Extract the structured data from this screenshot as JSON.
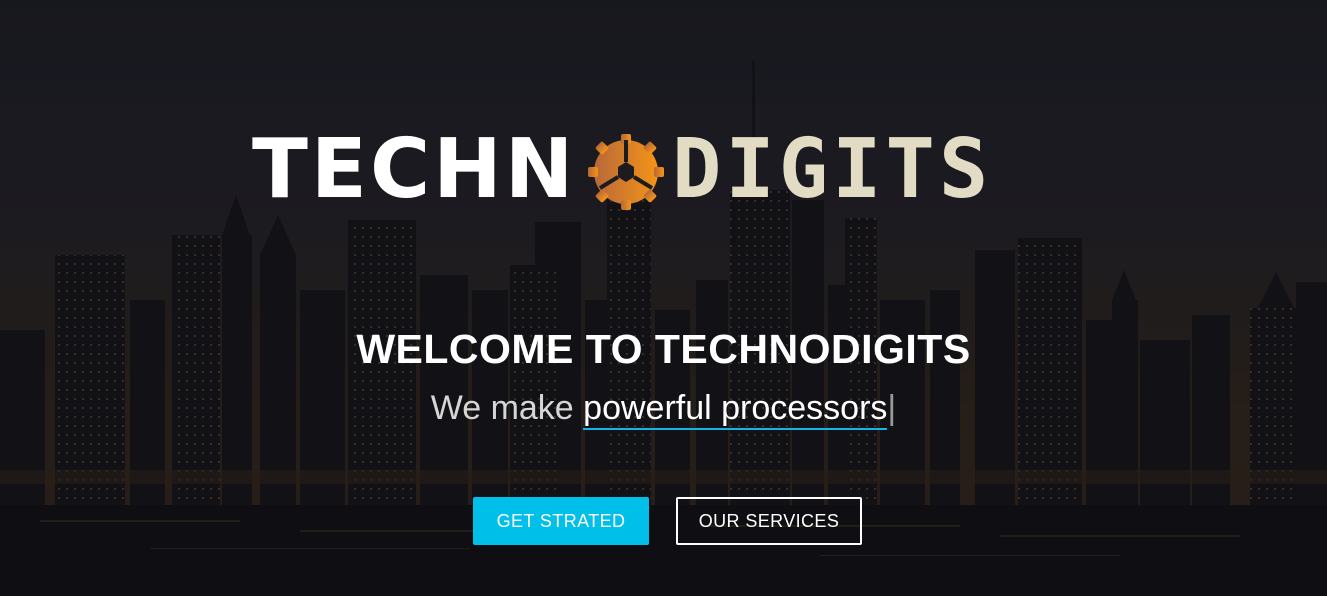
{
  "brand": {
    "name_left": "TECHN",
    "name_right": "DIGITS",
    "logo_icon": "orange-gear-icon",
    "colors": {
      "left_text": "#ffffff",
      "right_text": "#e2dcc4",
      "gear": "#ee8a1d"
    }
  },
  "hero": {
    "headline": "WELCOME TO TECHNODIGITS",
    "tagline_prefix": "We make",
    "tagline_typed": "powerful processors",
    "tagline_cursor": "|"
  },
  "buttons": {
    "primary_label": "GET STRATED",
    "secondary_label": "OUR SERVICES",
    "primary_color": "#00bfe8"
  },
  "background": {
    "description_icon": "city-skyline-night"
  }
}
